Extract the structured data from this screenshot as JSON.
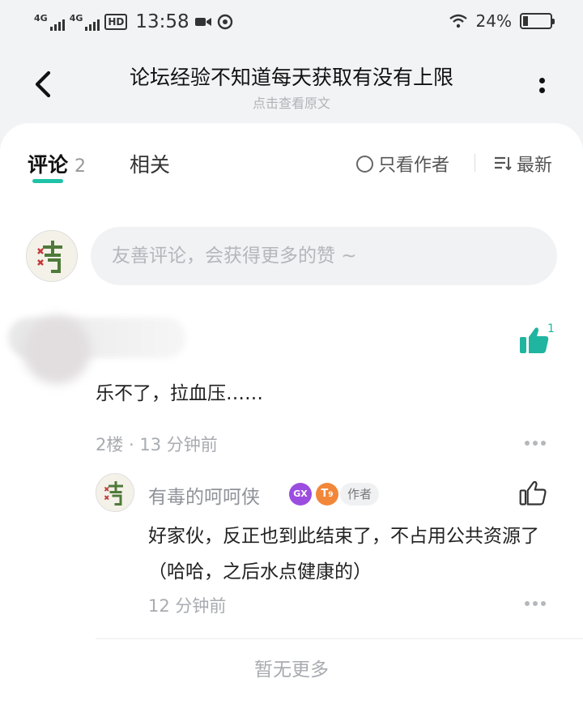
{
  "status_bar": {
    "signal_1": "4G",
    "signal_2": "4G",
    "hd_label": "HD",
    "time": "13:58",
    "battery": "24%"
  },
  "nav": {
    "title": "论坛经验不知道每天获取有没有上限",
    "subtitle": "点击查看原文"
  },
  "tabs": {
    "comments_label": "评论",
    "comments_count": "2",
    "related_label": "相关",
    "author_only_label": "只看作者",
    "sort_label": "最新"
  },
  "comment_input": {
    "placeholder": "友善评论，会获得更多的赞 ~"
  },
  "comments": [
    {
      "likes": "1",
      "text": "乐不了，拉血压……",
      "meta": "2楼 · 13 分钟前",
      "replies": [
        {
          "username": "有毒的呵呵侠",
          "level": "9",
          "author_tag": "作者",
          "text": "好家伙，反正也到此结束了，不占用公共资源了（哈哈，之后水点健康的）",
          "time": "12 分钟前"
        }
      ]
    }
  ],
  "footer": {
    "no_more": "暂无更多"
  },
  "colors": {
    "accent": "#1fc2a7",
    "game_badge": "#9b4de0",
    "level_badge": "#f2873a"
  }
}
